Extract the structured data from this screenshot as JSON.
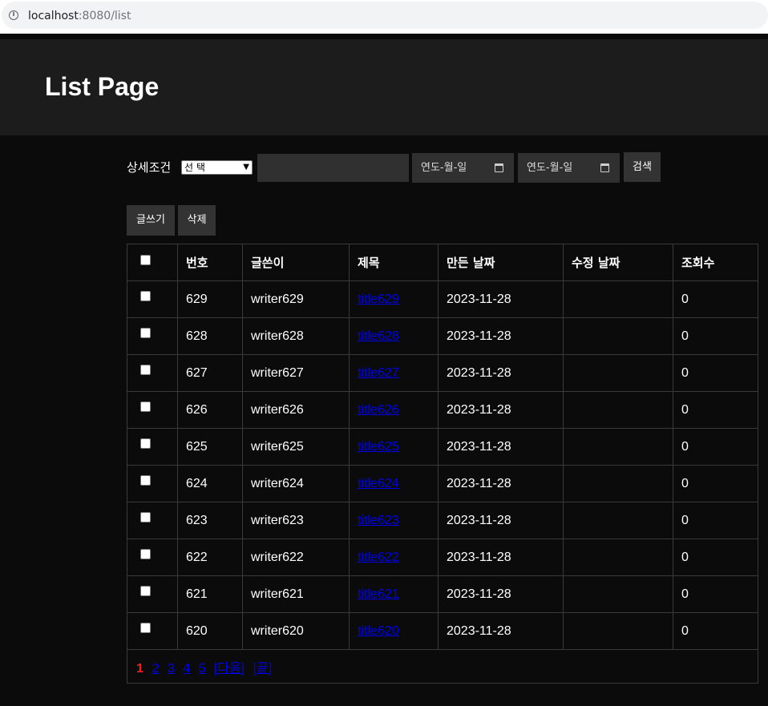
{
  "browser": {
    "host": "localhost",
    "path": ":8080/list",
    "info_icon": "info-icon"
  },
  "header": {
    "title": "List Page"
  },
  "search": {
    "label": "상세조건",
    "select_value": "선 택",
    "text_value": "",
    "date_from": "연도-월-일",
    "date_to": "연도-월-일",
    "search_button": "검색"
  },
  "actions": {
    "write_button": "글쓰기",
    "delete_button": "삭제"
  },
  "table": {
    "headers": [
      "번호",
      "글쓴이",
      "제목",
      "만든 날짜",
      "수정 날짜",
      "조회수"
    ],
    "rows": [
      {
        "no": "629",
        "writer": "writer629",
        "title": "title629",
        "created": "2023-11-28",
        "modified": "",
        "views": "0"
      },
      {
        "no": "628",
        "writer": "writer628",
        "title": "title628",
        "created": "2023-11-28",
        "modified": "",
        "views": "0"
      },
      {
        "no": "627",
        "writer": "writer627",
        "title": "title627",
        "created": "2023-11-28",
        "modified": "",
        "views": "0"
      },
      {
        "no": "626",
        "writer": "writer626",
        "title": "title626",
        "created": "2023-11-28",
        "modified": "",
        "views": "0"
      },
      {
        "no": "625",
        "writer": "writer625",
        "title": "title625",
        "created": "2023-11-28",
        "modified": "",
        "views": "0"
      },
      {
        "no": "624",
        "writer": "writer624",
        "title": "title624",
        "created": "2023-11-28",
        "modified": "",
        "views": "0"
      },
      {
        "no": "623",
        "writer": "writer623",
        "title": "title623",
        "created": "2023-11-28",
        "modified": "",
        "views": "0"
      },
      {
        "no": "622",
        "writer": "writer622",
        "title": "title622",
        "created": "2023-11-28",
        "modified": "",
        "views": "0"
      },
      {
        "no": "621",
        "writer": "writer621",
        "title": "title621",
        "created": "2023-11-28",
        "modified": "",
        "views": "0"
      },
      {
        "no": "620",
        "writer": "writer620",
        "title": "title620",
        "created": "2023-11-28",
        "modified": "",
        "views": "0"
      }
    ]
  },
  "pagination": {
    "current": "1",
    "pages": [
      "2",
      "3",
      "4",
      "5"
    ],
    "next": "[다음]",
    "last": "[끝]"
  },
  "colors": {
    "background": "#0b0b0b",
    "header_bg": "#1c1c1c",
    "button_bg": "#333333",
    "link": "#0000ee",
    "current_page": "#ff1a1a"
  }
}
